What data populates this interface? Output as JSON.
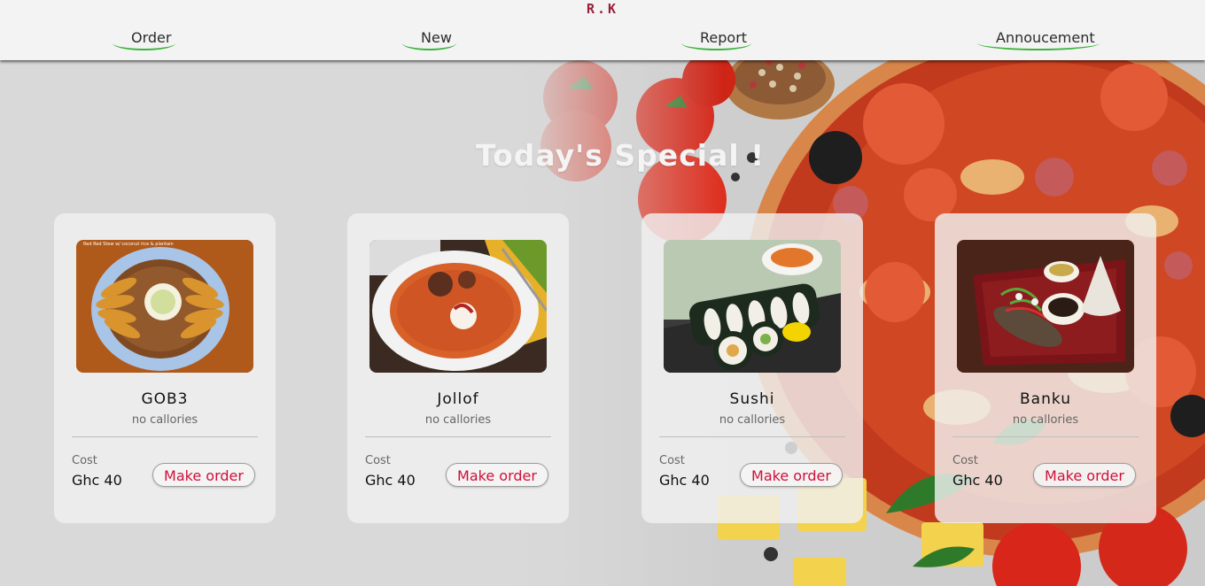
{
  "brand": "R.K",
  "nav": {
    "order": "Order",
    "new": "New",
    "report": "Report",
    "annoucement": "Annoucement"
  },
  "heading": "Today's Special !",
  "colors": {
    "accent_underline": "#3db33d",
    "button_text": "#d0103a",
    "brand": "#9a2038"
  },
  "cards": [
    {
      "name": "GOB3",
      "calories": "no callories",
      "cost_label": "Cost",
      "price": "Ghc 40",
      "button": "Make order",
      "image": "red-red-stew-coconut-rice-plantain",
      "image_caption": "Red Red Stew w/ coconut rice & plantain"
    },
    {
      "name": "Jollof",
      "calories": "no callories",
      "cost_label": "Cost",
      "price": "Ghc 40",
      "button": "Make order",
      "image": "jollof-rice-plate"
    },
    {
      "name": "Sushi",
      "calories": "no callories",
      "cost_label": "Cost",
      "price": "Ghc 40",
      "button": "Make order",
      "image": "sushi-rolls"
    },
    {
      "name": "Banku",
      "calories": "no callories",
      "cost_label": "Cost",
      "price": "Ghc 40",
      "button": "Make order",
      "image": "banku-tilapia-plate"
    }
  ]
}
